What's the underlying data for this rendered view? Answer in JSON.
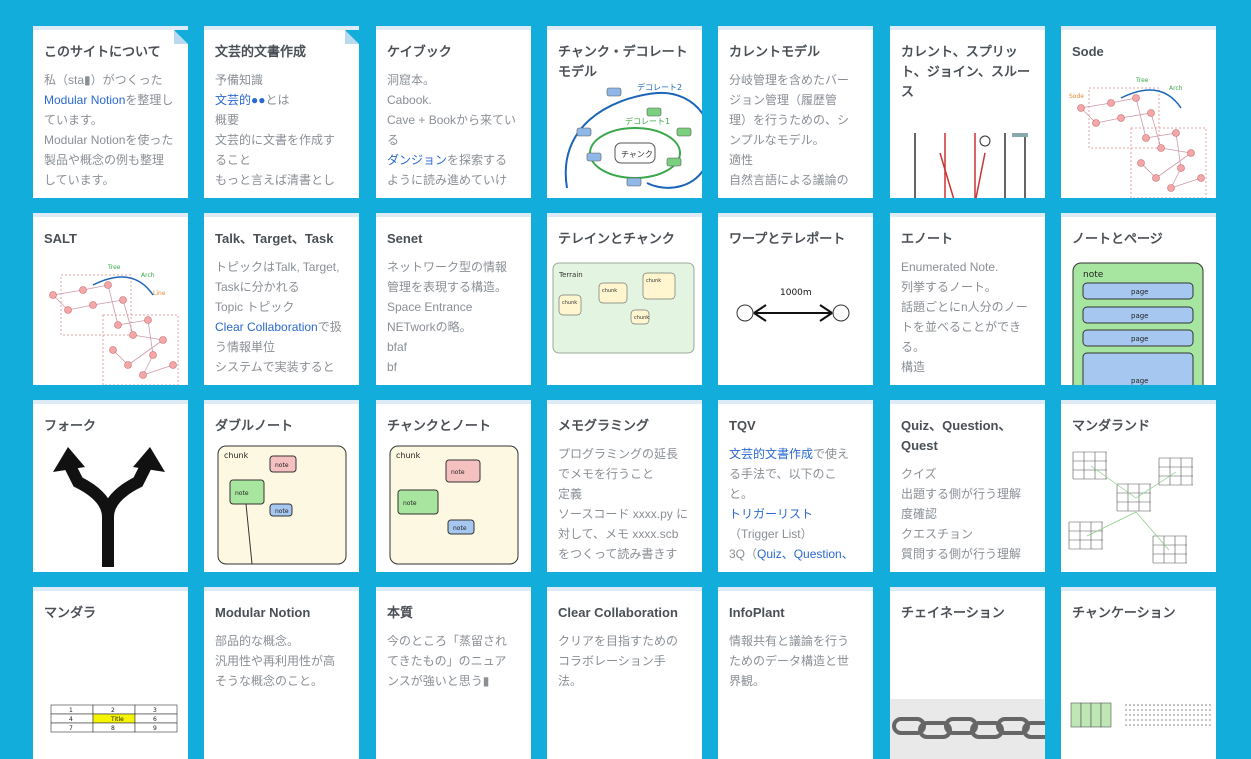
{
  "cards": [
    {
      "title": "このサイトについて",
      "pinned": true,
      "lines": [
        {
          "t": "私（sta▮）がつくった"
        },
        {
          "t": "Modular Notion",
          "link": true,
          "tail": "を整理し"
        },
        {
          "t": "ています。"
        },
        {
          "t": "Modular Notionを使った"
        },
        {
          "t": "製品や概念の例も整理"
        },
        {
          "t": "しています。"
        }
      ]
    },
    {
      "title": "文芸的文書作成",
      "pinned": true,
      "lines": [
        {
          "t": "予備知識"
        },
        {
          "t": "文芸的●●",
          "link": true,
          "tail": "とは"
        },
        {
          "t": "概要"
        },
        {
          "t": "文芸的に文書を作成す"
        },
        {
          "t": "ること"
        },
        {
          "t": "もっと言えば清書とし"
        }
      ]
    },
    {
      "title": "ケイブック",
      "lines": [
        {
          "t": "洞窟本。"
        },
        {
          "t": "Cabook."
        },
        {
          "t": "Cave + Bookから来てい"
        },
        {
          "t": "る"
        },
        {
          "t": "ダンジョン",
          "link": true,
          "tail": "を探索する"
        },
        {
          "t": "ように読み進めていけ"
        }
      ]
    },
    {
      "title": "チャンク・デコレートモデル",
      "thumb": "chunkdeco",
      "label1": "デコレート2",
      "label2": "デコレート1",
      "label3": "チャンク"
    },
    {
      "title": "カレントモデル",
      "lines": [
        {
          "t": "分岐管理を含めたバー"
        },
        {
          "t": "ジョン管理（履歴管"
        },
        {
          "t": "理）を行うための、シ"
        },
        {
          "t": "ンプルなモデル。"
        },
        {
          "t": "適性"
        },
        {
          "t": "自然言語による議論の"
        }
      ]
    },
    {
      "title": "カレント、スプリット、ジョイン、スルース",
      "thumb": "arrows"
    },
    {
      "title": "Sode",
      "thumb": "tree",
      "label1": "Tree",
      "label2": "Arch",
      "label3": "Sode"
    },
    {
      "title": "SALT",
      "thumb": "tree2",
      "label1": "Tree",
      "label2": "Arch",
      "label3": "Line"
    },
    {
      "title": "Talk、Target、Task",
      "lines": [
        {
          "t": "トピックはTalk, Target,"
        },
        {
          "t": "Taskに分かれる"
        },
        {
          "t": "Topic トピック"
        },
        {
          "t": "Clear Collaboration",
          "link": true,
          "tail": "で扱"
        },
        {
          "t": "う情報単位"
        },
        {
          "t": "システムで実装すると"
        }
      ]
    },
    {
      "title": "Senet",
      "lines": [
        {
          "t": "ネットワーク型の情報"
        },
        {
          "t": "管理を表現する構造。"
        },
        {
          "t": "Space Entrance"
        },
        {
          "t": "NETworkの略。"
        },
        {
          "t": "bfaf"
        },
        {
          "t": "bf"
        }
      ]
    },
    {
      "title": "テレインとチャンク",
      "thumb": "terrain",
      "label1": "Terrain",
      "label2": "chunk"
    },
    {
      "title": "ワープとテレポート",
      "thumb": "warp",
      "label1": "1000m"
    },
    {
      "title": "エノート",
      "lines": [
        {
          "t": "Enumerated Note."
        },
        {
          "t": "列挙するノート。"
        },
        {
          "t": "話題ごとにn人分のノー"
        },
        {
          "t": "トを並べることができ"
        },
        {
          "t": "る。"
        },
        {
          "t": "構造"
        }
      ]
    },
    {
      "title": "ノートとページ",
      "thumb": "notepage",
      "label1": "note",
      "label2": "page"
    },
    {
      "title": "フォーク",
      "thumb": "fork"
    },
    {
      "title": "ダブルノート",
      "thumb": "doublenote",
      "label1": "chunk",
      "label2": "note"
    },
    {
      "title": "チャンクとノート",
      "thumb": "chunknote",
      "label1": "chunk",
      "label2": "note"
    },
    {
      "title": "メモグラミング",
      "lines": [
        {
          "t": "プログラミングの延長"
        },
        {
          "t": "でメモを行うこと"
        },
        {
          "t": "定義"
        },
        {
          "t": "ソースコード xxxx.py に"
        },
        {
          "t": "対して、メモ xxxx.scb"
        },
        {
          "t": "をつくって読み書きす"
        }
      ]
    },
    {
      "title": "TQV",
      "lines": [
        {
          "t": "文芸的文書作成",
          "link": true,
          "tail": "で使え"
        },
        {
          "t": "る手法で、以下のこ"
        },
        {
          "t": "と。"
        },
        {
          "t": "トリガーリスト",
          "link": true
        },
        {
          "t": "（Trigger List）"
        },
        {
          "t": "3Q（",
          "linkmid": "Quiz、Question、"
        }
      ]
    },
    {
      "title": "Quiz、Question、Quest",
      "lines": [
        {
          "t": "クイズ"
        },
        {
          "t": "出題する側が行う理解"
        },
        {
          "t": "度確認"
        },
        {
          "t": "クエスチョン"
        },
        {
          "t": "質問する側が行う理解"
        }
      ]
    },
    {
      "title": "マンダランド",
      "thumb": "mandaland"
    },
    {
      "title": "マンダラ",
      "thumb": "mandala",
      "cells": [
        "1",
        "2",
        "3",
        "4",
        "Title",
        "6",
        "7",
        "8",
        "9"
      ]
    },
    {
      "title": "Modular Notion",
      "lines": [
        {
          "t": "部品的な概念。"
        },
        {
          "t": "汎用性や再利用性が高"
        },
        {
          "t": "そうな概念のこと。"
        }
      ]
    },
    {
      "title": "本質",
      "lines": [
        {
          "t": "今のところ「蒸留され"
        },
        {
          "t": "てきたもの」のニュア"
        },
        {
          "t": "ンスが強いと思う▮"
        }
      ]
    },
    {
      "title": "Clear Collaboration",
      "lines": [
        {
          "t": "クリアを目指すための"
        },
        {
          "t": "コラボレーション手"
        },
        {
          "t": "法。"
        }
      ]
    },
    {
      "title": "InfoPlant",
      "lines": [
        {
          "t": "情報共有と議論を行う"
        },
        {
          "t": "ためのデータ構造と世"
        },
        {
          "t": "界観。"
        }
      ]
    },
    {
      "title": "チェイネーション",
      "thumb": "chain"
    },
    {
      "title": "チャンケーション",
      "thumb": "chunkation"
    }
  ]
}
